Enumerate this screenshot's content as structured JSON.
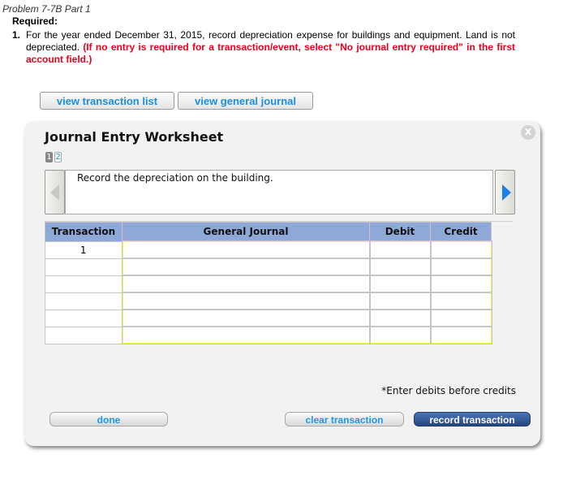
{
  "problem": {
    "title": "Problem 7-7B Part 1",
    "required_label": "Required:",
    "items": [
      {
        "number": "1.",
        "text": "For the year ended December 31, 2015, record depreciation expense for buildings and equipment. Land is not depreciated.",
        "instruction": "(If no entry is required for a transaction/event, select \"No journal entry required\" in the first account field.)"
      }
    ]
  },
  "toolbar": {
    "view_transaction_list": "view transaction list",
    "view_general_journal": "view general journal"
  },
  "worksheet": {
    "title": "Journal Entry Worksheet",
    "close_label": "X",
    "pages": [
      {
        "label": "1",
        "active": true
      },
      {
        "label": "2",
        "active": false
      }
    ],
    "prompt": "Record the depreciation on the building.",
    "table": {
      "headers": [
        "Transaction",
        "General Journal",
        "Debit",
        "Credit"
      ],
      "rows": [
        {
          "transaction": "1",
          "account": "",
          "debit": "",
          "credit": ""
        },
        {
          "transaction": "",
          "account": "",
          "debit": "",
          "credit": ""
        },
        {
          "transaction": "",
          "account": "",
          "debit": "",
          "credit": ""
        },
        {
          "transaction": "",
          "account": "",
          "debit": "",
          "credit": ""
        },
        {
          "transaction": "",
          "account": "",
          "debit": "",
          "credit": ""
        },
        {
          "transaction": "",
          "account": "",
          "debit": "",
          "credit": ""
        }
      ]
    },
    "note": "*Enter debits before credits",
    "buttons": {
      "done": "done",
      "clear": "clear transaction",
      "record": "record transaction"
    }
  }
}
